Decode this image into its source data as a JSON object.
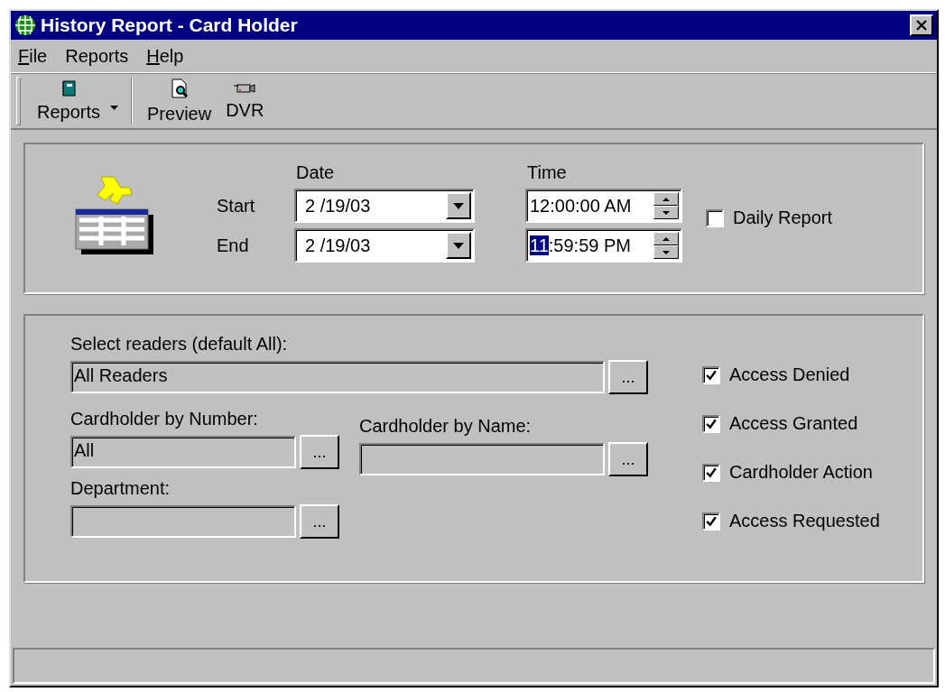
{
  "window": {
    "title": "History Report - Card Holder"
  },
  "menu": [
    {
      "label": "File",
      "underline_first": true
    },
    {
      "label": "Reports",
      "underline_first": false
    },
    {
      "label": "Help",
      "underline_first": true
    }
  ],
  "toolbar": [
    {
      "label": "Reports",
      "has_dropdown": true
    },
    {
      "label": "Preview",
      "has_dropdown": false
    },
    {
      "label": "DVR",
      "has_dropdown": false
    }
  ],
  "date_range": {
    "date_header": "Date",
    "time_header": "Time",
    "rows": [
      {
        "label": "Start",
        "date": "2 /19/03",
        "time_parts": [
          {
            "text": "12:00:00 AM",
            "selected": false
          }
        ]
      },
      {
        "label": "End",
        "date": "2 /19/03",
        "time_parts": [
          {
            "text": "11",
            "selected": true
          },
          {
            "text": ":59:59 PM",
            "selected": false
          }
        ]
      }
    ]
  },
  "daily_report": {
    "label": "Daily Report",
    "checked": false
  },
  "filters": {
    "readers": {
      "label": "Select readers (default All):",
      "value": "All Readers",
      "button": "..."
    },
    "by_number": {
      "label": "Cardholder by Number:",
      "value": "All",
      "button": "..."
    },
    "by_name": {
      "label": "Cardholder by Name:",
      "button": "..."
    },
    "department": {
      "label": "Department:",
      "button": "..."
    }
  },
  "event_types": [
    {
      "label": "Access Denied",
      "checked": true
    },
    {
      "label": "Access Granted",
      "checked": true
    },
    {
      "label": "Cardholder Action",
      "checked": true
    },
    {
      "label": "Access Requested",
      "checked": true
    }
  ]
}
